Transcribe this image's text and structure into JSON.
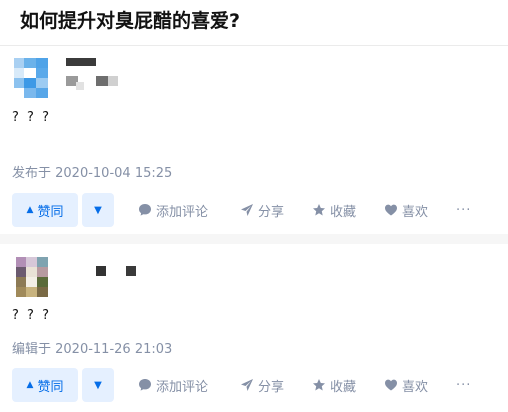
{
  "question": {
    "title": "如何提升对臭屁醋的喜爱?"
  },
  "answers": [
    {
      "body": "? ? ?",
      "meta": "发布于 2020-10-04 15:25",
      "actions": {
        "upvote_label": "赞同",
        "comment_label": "添加评论",
        "share_label": "分享",
        "favorite_label": "收藏",
        "like_label": "喜欢",
        "more_label": "···"
      }
    },
    {
      "body": "? ? ?",
      "meta": "编辑于 2020-11-26 21:03",
      "actions": {
        "upvote_label": "赞同",
        "comment_label": "添加评论",
        "share_label": "分享",
        "favorite_label": "收藏",
        "like_label": "喜欢",
        "more_label": "···"
      }
    }
  ],
  "colors": {
    "accent": "#056de8",
    "accent_bg": "#e5f0ff",
    "muted": "#8590a6"
  },
  "icons": [
    "upvote-triangle-icon",
    "downvote-triangle-icon",
    "comment-bubble-icon",
    "paper-plane-icon",
    "star-icon",
    "heart-icon",
    "more-dots-icon"
  ]
}
